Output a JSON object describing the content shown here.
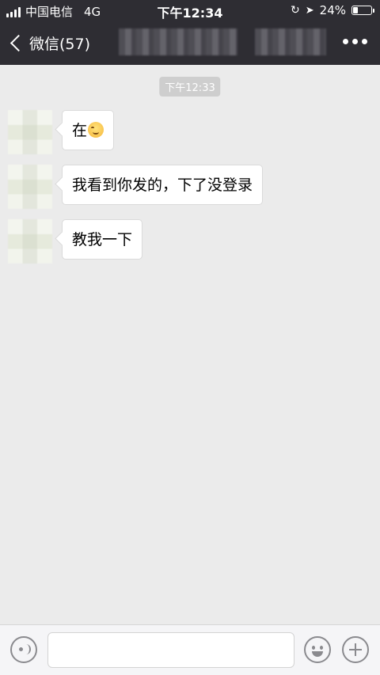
{
  "status_bar": {
    "carrier": "中国电信",
    "network": "4G",
    "time": "下午12:34",
    "battery_percent": "24%",
    "battery_level": 0.24
  },
  "nav": {
    "back_label": "微信(57)",
    "more_icon": "more-dots-icon"
  },
  "chat": {
    "timestamp": "下午12:33",
    "messages": [
      {
        "text": "在",
        "emoji": "smiling-face"
      },
      {
        "text": "我看到你发的，下了没登录"
      },
      {
        "text": "教我一下"
      }
    ]
  },
  "input_bar": {
    "voice_icon": "voice-icon",
    "emoji_icon": "emoji-icon",
    "plus_icon": "plus-icon",
    "text_value": ""
  },
  "colors": {
    "header_bg": "#2e2d33",
    "chat_bg": "#ebebeb",
    "bubble_bg": "#ffffff"
  }
}
